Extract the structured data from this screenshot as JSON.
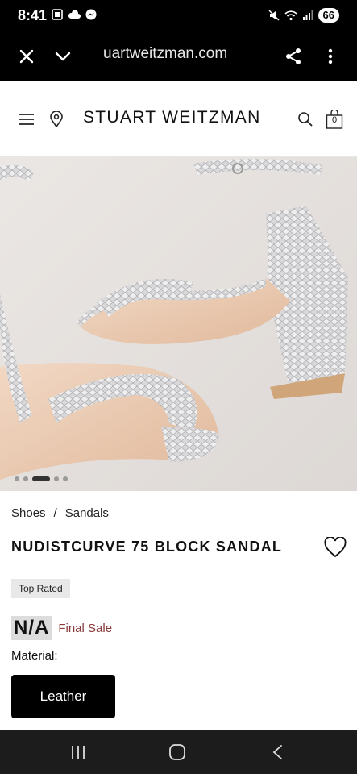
{
  "status": {
    "time": "8:41",
    "battery": "66"
  },
  "browser": {
    "url": "uartweitzman.com"
  },
  "header": {
    "brand": "STUART WEITZMAN",
    "cart_count": "0"
  },
  "carousel": {
    "total": 5,
    "active_index": 2
  },
  "breadcrumb": {
    "items": [
      "Shoes",
      "Sandals"
    ],
    "separator": "/"
  },
  "product": {
    "title": "NUDISTCURVE 75 BLOCK SANDAL",
    "badge": "Top Rated",
    "price": "N/A",
    "sale_note": "Final Sale",
    "material_label": "Material:",
    "material_option": "Leather"
  },
  "icons": {
    "close": "close-icon",
    "chevron": "chevron-down-icon",
    "share": "share-icon",
    "more": "more-vert-icon",
    "menu": "menu-icon",
    "location": "location-pin-icon",
    "search": "search-icon",
    "bag": "shopping-bag-icon",
    "heart": "heart-icon"
  },
  "colors": {
    "final_sale": "#8a3a3a",
    "hero_bg": "#e6e2df",
    "button_bg": "#000000"
  }
}
